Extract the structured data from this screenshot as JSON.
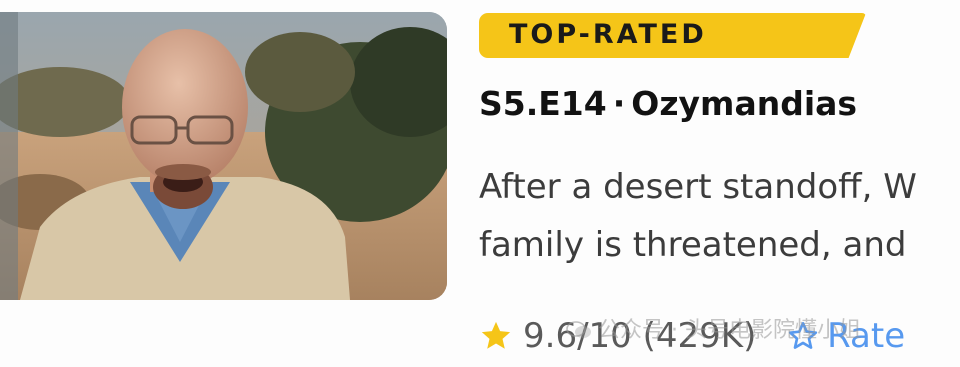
{
  "badge": {
    "label": "TOP-RATED"
  },
  "episode": {
    "code": "S5.E14",
    "separator": "·",
    "title": "Ozymandias"
  },
  "description": {
    "line1": "After a desert standoff, W",
    "line2": "family is threatened, and"
  },
  "rating": {
    "score": "9.6/10",
    "votes": "(429K)",
    "rate_label": "Rate"
  },
  "watermark": {
    "text": "公众号 · 头号电影院懂小姐"
  },
  "colors": {
    "badge": "#f5c518",
    "rate_accent": "#5799ef",
    "star": "#f5c518"
  }
}
